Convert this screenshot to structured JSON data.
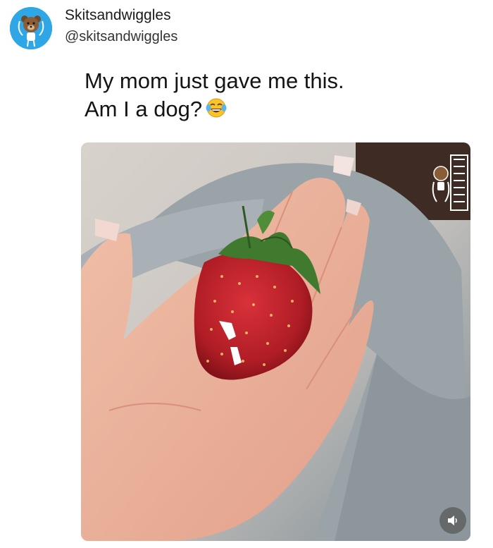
{
  "tweet": {
    "display_name": "Skitsandwiggles",
    "handle": "@skitsandwiggles",
    "text_line1": "My mom just gave me this.",
    "text_line2": "Am I a dog?",
    "emoji": "face-with-tears-of-joy-icon"
  },
  "media": {
    "description_icon": "strawberry-with-fangs-photo",
    "overlay_button": "speaker-icon"
  },
  "colors": {
    "avatar_bg": "#2fa6e6",
    "text": "#141414",
    "handle": "#333333"
  }
}
